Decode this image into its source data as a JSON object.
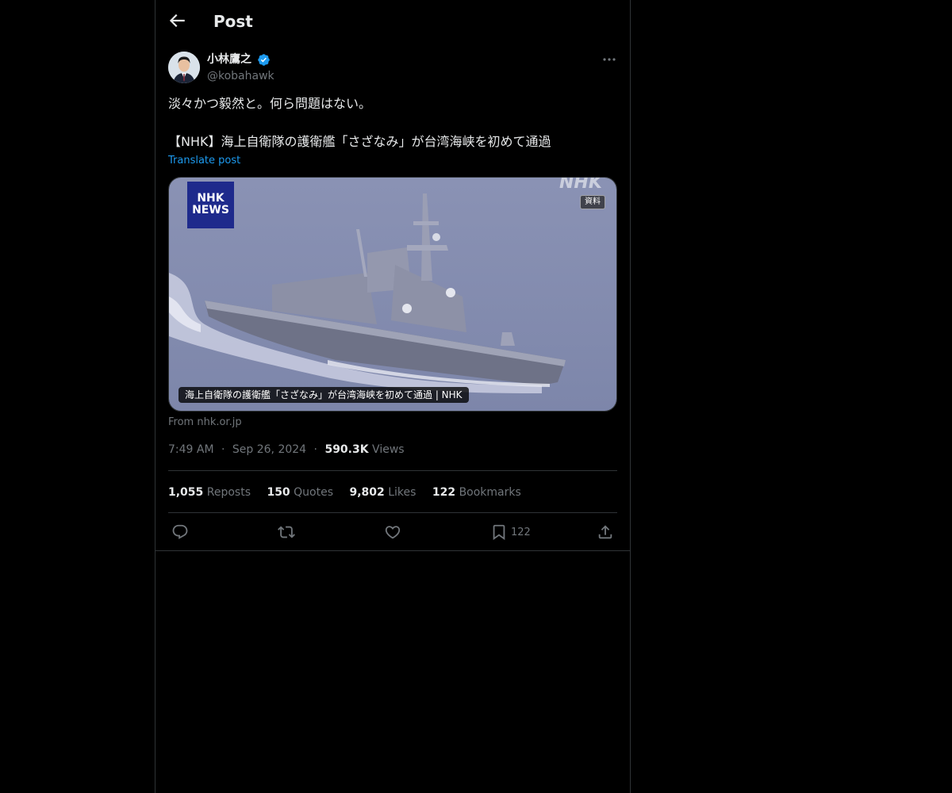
{
  "header": {
    "back_label": "Back",
    "title": "Post"
  },
  "author": {
    "name": "小林鷹之",
    "handle": "@kobahawk",
    "verified": true
  },
  "post": {
    "text": "淡々かつ毅然と。何ら問題はない。\n\n【NHK】海上自衛隊の護衛艦「さざなみ」が台湾海峡を初めて通過",
    "translate_label": "Translate post"
  },
  "card": {
    "logo_line1": "NHK",
    "logo_line2": "NEWS",
    "watermark": "NHK",
    "badge": "資料",
    "caption": "海上自衛隊の護衛艦「さざなみ」が台湾海峡を初めて通過 | NHK",
    "source": "From nhk.or.jp"
  },
  "meta": {
    "time": "7:49 AM",
    "date": "Sep 26, 2024",
    "views_count": "590.3K",
    "views_label": "Views",
    "separator": "·"
  },
  "stats": [
    {
      "count": "1,055",
      "label": "Reposts"
    },
    {
      "count": "150",
      "label": "Quotes"
    },
    {
      "count": "9,802",
      "label": "Likes"
    },
    {
      "count": "122",
      "label": "Bookmarks"
    }
  ],
  "actions": {
    "bookmark_count": "122"
  },
  "colors": {
    "background": "#000000",
    "text": "#e7e9ea",
    "muted": "#71767b",
    "accent": "#1d9bf0",
    "border": "#2f3336"
  },
  "icons": {
    "back": "arrow-left-icon",
    "verified": "verified-badge-icon",
    "more": "more-horizontal-icon",
    "reply": "reply-icon",
    "repost": "repost-icon",
    "like": "heart-icon",
    "bookmark": "bookmark-icon",
    "share": "share-icon"
  }
}
